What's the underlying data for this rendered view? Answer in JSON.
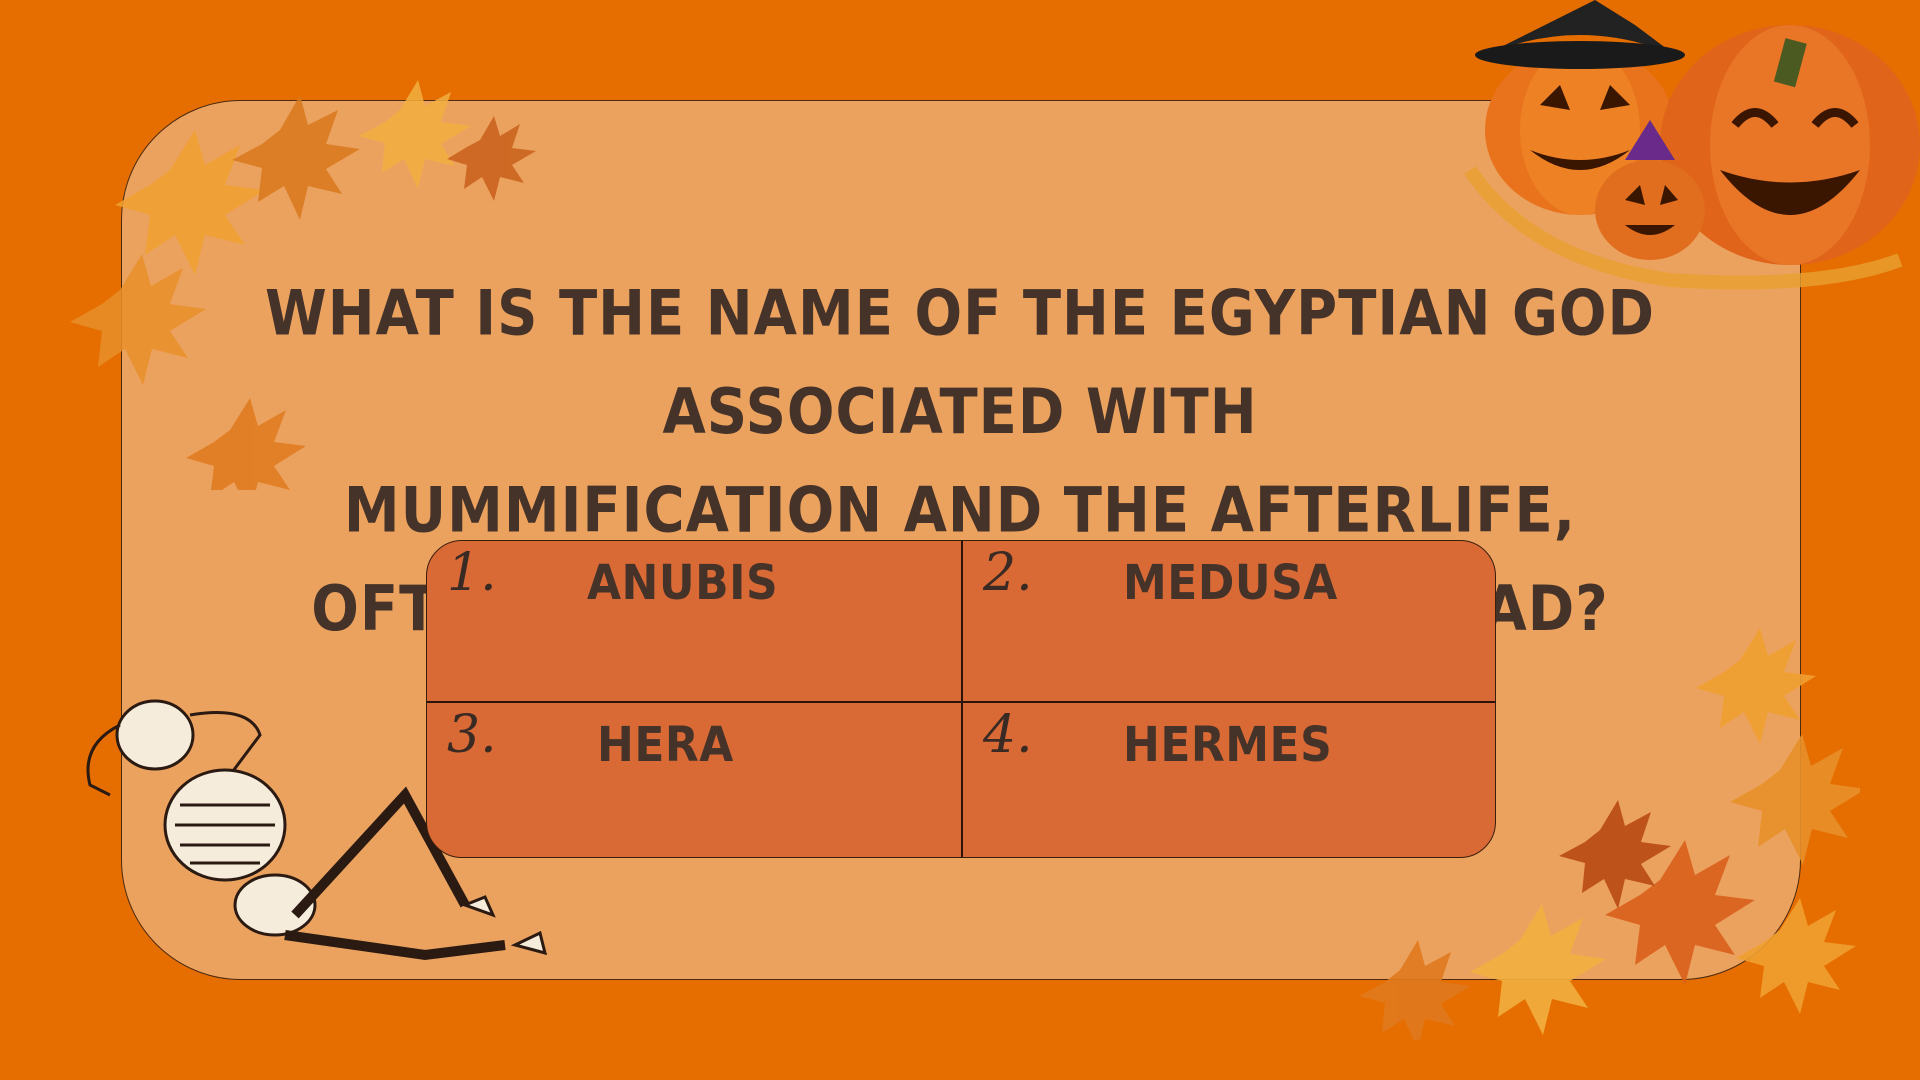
{
  "question": {
    "lines": [
      "WHAT IS THE NAME OF THE EGYPTIAN GOD ASSOCIATED WITH",
      "MUMMIFICATION AND THE AFTERLIFE,",
      "OFTEN DEPICTED WITH A JACKAL HEAD?"
    ]
  },
  "answers": [
    {
      "number": "1.",
      "label": "ANUBIS"
    },
    {
      "number": "2.",
      "label": "MEDUSA"
    },
    {
      "number": "3.",
      "label": "HERA"
    },
    {
      "number": "4.",
      "label": "HERMES"
    }
  ],
  "colors": {
    "background": "#e66d00",
    "card": "#eca25f",
    "answer_box": "#d96a36",
    "text": "#453228"
  },
  "decorations": [
    "autumn-leaves-top-left",
    "jack-o-lanterns-top-right",
    "autumn-leaves-bottom-right",
    "skeleton-bottom-left"
  ]
}
